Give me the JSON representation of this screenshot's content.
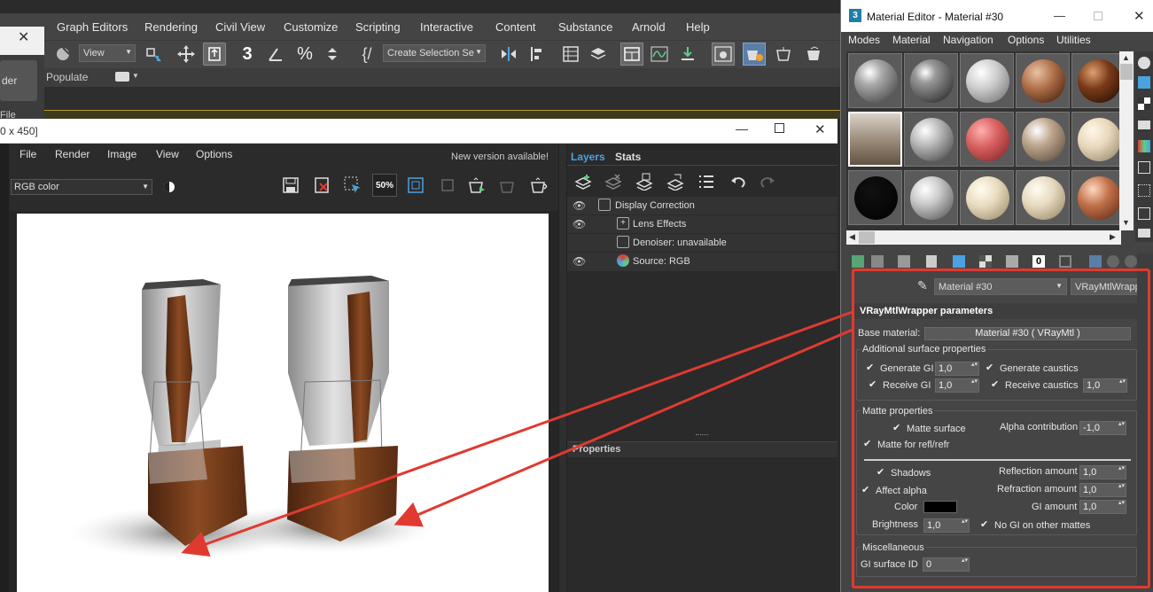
{
  "max": {
    "menu": [
      "Graph Editors",
      "Rendering",
      "Civil View",
      "Customize",
      "Scripting",
      "Interactive",
      "Content",
      "Substance",
      "Arnold",
      "Help"
    ],
    "view_combo": "View",
    "selection_set_combo": "Create Selection Se",
    "populate": "Populate",
    "left_dialog_button": "der",
    "left_dialog_label": "File"
  },
  "frame_buffer": {
    "title": "0 x 450]",
    "menu": [
      "File",
      "Render",
      "Image",
      "View",
      "Options"
    ],
    "new_version": "New version available!",
    "channel_combo": "RGB color",
    "zoom": "50%"
  },
  "layers_panel": {
    "tabs": [
      "Layers",
      "Stats"
    ],
    "layers": [
      {
        "name": "Display Correction",
        "visible": true
      },
      {
        "name": "Lens Effects",
        "visible": true
      },
      {
        "name": "Denoiser: unavailable",
        "visible": false
      },
      {
        "name": "Source: RGB",
        "visible": true
      }
    ],
    "properties_label": "Properties"
  },
  "material_editor": {
    "title": "Material Editor - Material #30",
    "menu": [
      "Modes",
      "Material",
      "Navigation",
      "Options",
      "Utilities"
    ],
    "material_name": "Material #30",
    "material_type": "VRayMtlWrapper",
    "rollout_title": "VRayMtlWrapper parameters",
    "base_material_label": "Base material:",
    "base_material_value": "Material #30  ( VRayMtl )",
    "additional": {
      "title": "Additional surface properties",
      "generate_gi": "Generate GI",
      "generate_gi_value": "1,0",
      "generate_caustics": "Generate caustics",
      "receive_gi": "Receive GI",
      "receive_gi_value": "1,0",
      "receive_caustics": "Receive caustics",
      "receive_caustics_value": "1,0"
    },
    "matte": {
      "title": "Matte properties",
      "matte_surface": "Matte surface",
      "alpha_contribution": "Alpha contribution",
      "alpha_contribution_value": "-1,0",
      "matte_for_refl": "Matte for refl/refr",
      "shadows": "Shadows",
      "affect_alpha": "Affect alpha",
      "color": "Color",
      "brightness": "Brightness",
      "brightness_value": "1,0",
      "reflection_amount": "Reflection amount",
      "reflection_amount_value": "1,0",
      "refraction_amount": "Refraction amount",
      "refraction_amount_value": "1,0",
      "gi_amount": "GI amount",
      "gi_amount_value": "1,0",
      "no_gi_other": "No GI on other mattes",
      "color_swatch": "#000000"
    },
    "misc": {
      "title": "Miscellaneous",
      "gi_surface_id": "GI surface ID",
      "gi_surface_id_value": "0"
    }
  },
  "colors": {
    "highlight_red": "#e03a30",
    "tab_active": "#4aa3df",
    "max_dark": "#444444"
  }
}
